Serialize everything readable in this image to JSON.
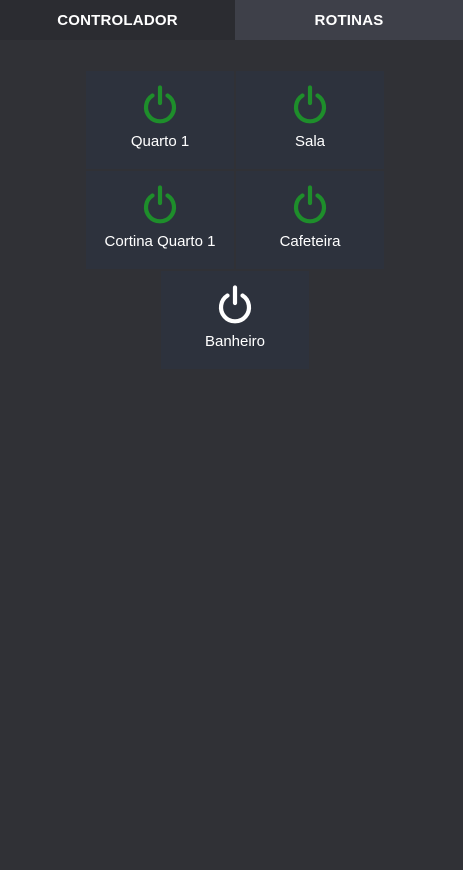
{
  "tabs": [
    {
      "label": "CONTROLADOR",
      "active": true
    },
    {
      "label": "ROTINAS",
      "active": false
    }
  ],
  "colors": {
    "on": "#1e8e2b",
    "off": "#ffffff",
    "background": "#303136",
    "tile": "#2d323d"
  },
  "devices": [
    {
      "label": "Quarto 1",
      "icon": "power-icon",
      "state": "on"
    },
    {
      "label": "Sala",
      "icon": "power-icon",
      "state": "on"
    },
    {
      "label": "Cortina Quarto 1",
      "icon": "power-icon",
      "state": "on"
    },
    {
      "label": "Cafeteira",
      "icon": "power-icon",
      "state": "on"
    },
    {
      "label": "Banheiro",
      "icon": "power-icon",
      "state": "off"
    }
  ]
}
